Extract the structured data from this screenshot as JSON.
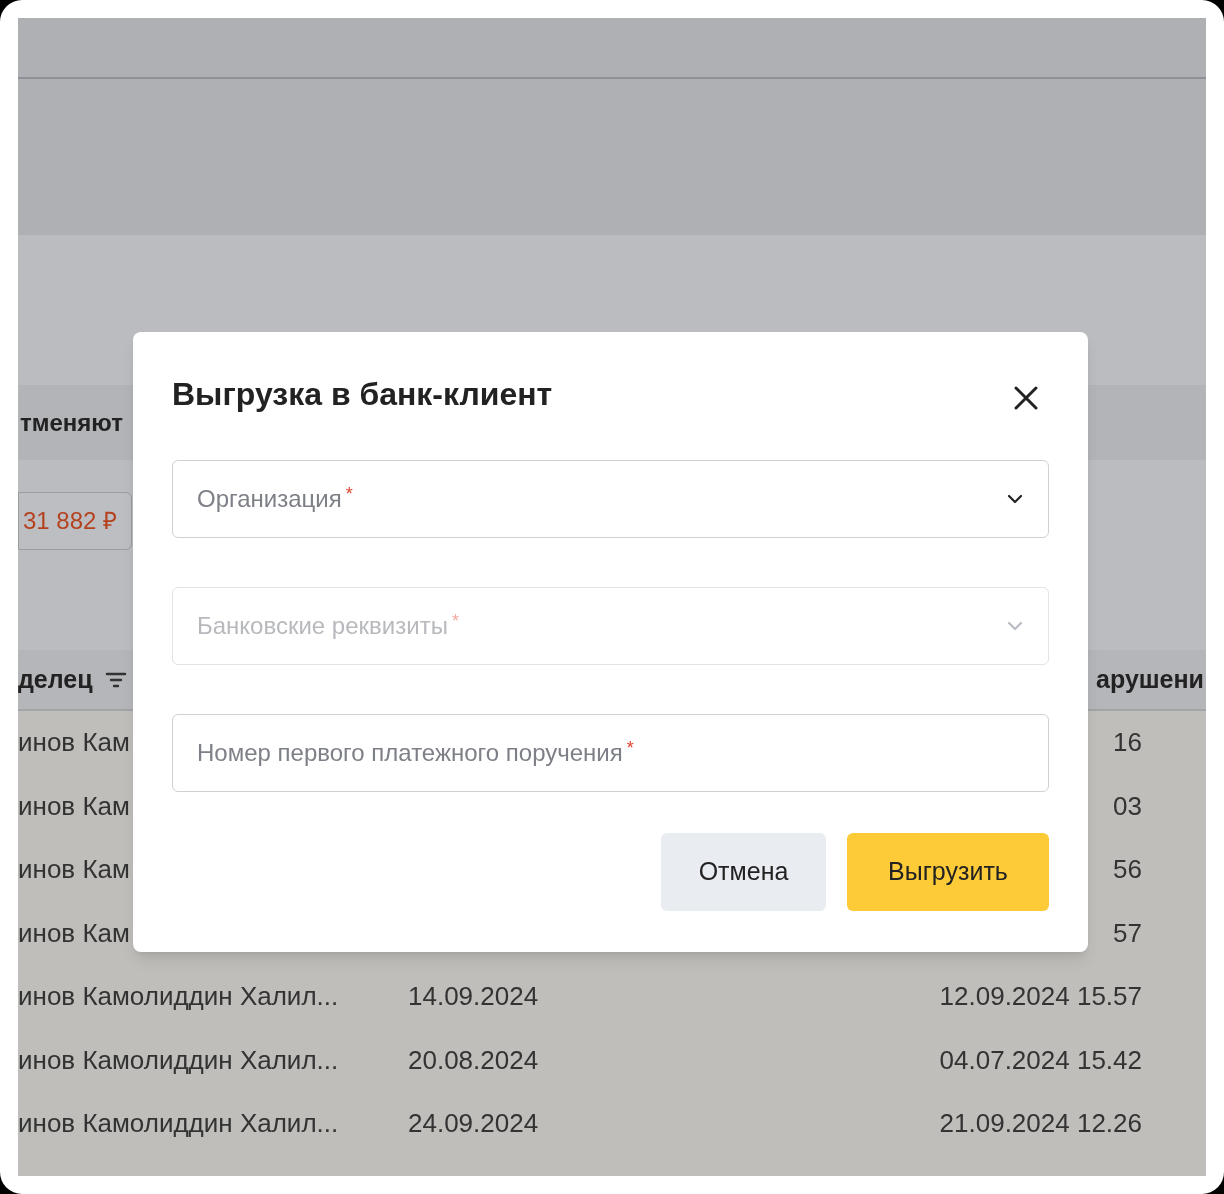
{
  "background": {
    "section_header": "тменяют",
    "amount_badge": "31 882 ₽",
    "table": {
      "columns": [
        {
          "label": "делец",
          "filter": true
        },
        {
          "label": "арушени"
        }
      ],
      "rows": [
        [
          "инов Кам",
          "",
          "16"
        ],
        [
          "инов Кам",
          "",
          "03"
        ],
        [
          "инов Кам",
          "",
          "56"
        ],
        [
          "инов Кам",
          "",
          "57"
        ],
        [
          "инов Камолиддин Халил...",
          "14.09.2024",
          "12.09.2024 15.57"
        ],
        [
          "инов Камолиддин Халил...",
          "20.08.2024",
          "04.07.2024 15.42"
        ],
        [
          "инов Камолиддин Халил...",
          "24.09.2024",
          "21.09.2024 12.26"
        ]
      ]
    }
  },
  "dialog": {
    "title": "Выгрузка в банк-клиент",
    "fields": [
      {
        "kind": "select",
        "placeholder": "Организация",
        "required_mark": "*",
        "disabled": false
      },
      {
        "kind": "select",
        "placeholder": "Банковские реквизиты",
        "required_mark": "*",
        "disabled": true
      },
      {
        "kind": "input",
        "placeholder": "Номер первого платежного поручения",
        "required_mark": "*",
        "disabled": false
      }
    ],
    "buttons": [
      {
        "label": "Отмена",
        "kind": "secondary"
      },
      {
        "label": "Выгрузить",
        "kind": "primary"
      }
    ]
  }
}
